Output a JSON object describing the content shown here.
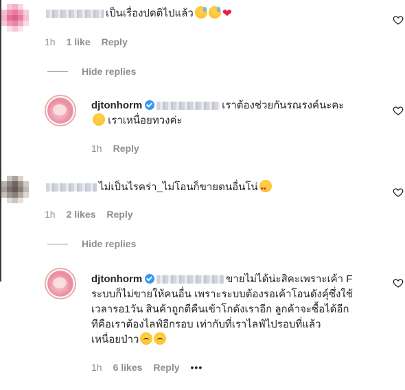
{
  "comments": [
    {
      "text": "เป็นเรื่องปดติไปแล้ว",
      "time": "1h",
      "likes": "1 like",
      "reply": "Reply",
      "hide_replies": "Hide replies",
      "replies": [
        {
          "username": "djtonhorm",
          "text_line1": "เราต้องช่วยกันรณรงค์นะคะ",
          "text_line2": "เราเหนื่อยทวงค่ะ",
          "time": "1h",
          "reply": "Reply"
        }
      ]
    },
    {
      "text": "ไม่เป็นไรคร่า_ไม่โอนก็ขายตนอื่นโน่",
      "time": "1h",
      "likes": "2 likes",
      "reply": "Reply",
      "hide_replies": "Hide replies",
      "replies": [
        {
          "username": "djtonhorm",
          "text_line1": "ขายไม่ได้น่ะสิคะเพราะเค้า F",
          "text_line2": "ระบบก็ไม่ขายให้คนอื่น เพราะระบบต้องรอเค้าโอนดังคุ์ซึ่งใช้",
          "text_line3": "เวลารอ1วัน สินค้าถูกตีคืนเข้าโกดังเราอีก ลูกค้าจะซื้อได้อีก",
          "text_line4": "ทีคือเราต้องไลฟ์อีกรอบ เท่ากับที่เราไลฟ์ไปรอบที่แล้ว",
          "text_line5": "เหนื่อยป่าว",
          "time": "1h",
          "likes": "6 likes",
          "reply": "Reply",
          "more": "•••"
        }
      ]
    }
  ],
  "icons": {
    "heart": "heart-outline-icon",
    "verified": "verified-badge-icon"
  },
  "colors": {
    "text": "#262626",
    "muted": "#8e8e8e",
    "verified": "#3897f0"
  }
}
